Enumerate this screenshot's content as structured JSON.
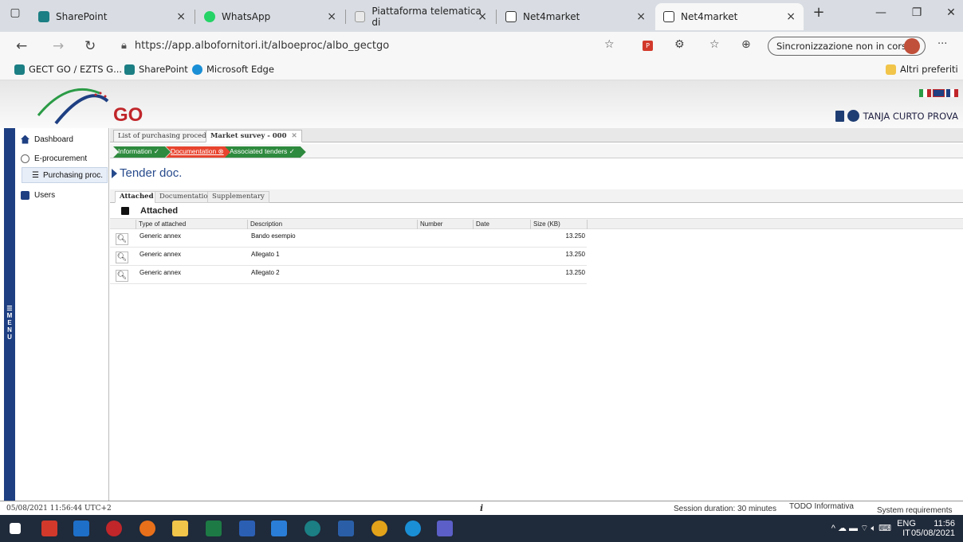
{
  "browser": {
    "tabs": [
      {
        "title": "SharePoint",
        "active": false
      },
      {
        "title": "WhatsApp",
        "active": false
      },
      {
        "title": "Piattaforma telematica di",
        "active": false
      },
      {
        "title": "Net4market",
        "active": false
      },
      {
        "title": "Net4market",
        "active": true
      }
    ],
    "new_tab": "+",
    "url": "https://app.albofornitori.it/alboeproc/albo_gectgo",
    "sync_label": "Sincronizzazione non in corso",
    "more": "···",
    "favorites": [
      "GECT GO / EZTS G...",
      "SharePoint",
      "Microsoft Edge"
    ],
    "other_favorites": "Altri preferiti"
  },
  "app": {
    "logo_text": "GO",
    "user_name": "TANJA CURTO PROVA",
    "menu_label": "MENU",
    "sidebar": [
      {
        "label": "Dashboard"
      },
      {
        "label": "E-procurement"
      },
      {
        "label": "Purchasing proc."
      },
      {
        "label": "Users"
      }
    ],
    "page_tabs": [
      {
        "label": "List of purchasing procedures"
      },
      {
        "label": "Market survey - 000"
      }
    ],
    "steps": [
      {
        "label": "Information",
        "status": "ok"
      },
      {
        "label": "Documentation",
        "status": "error"
      },
      {
        "label": "Associated tenders",
        "status": "ok"
      }
    ],
    "section_title": "Tender doc.",
    "doc_tabs": [
      "Attached",
      "Documentation",
      "Supplementary"
    ],
    "attached_header": "Attached",
    "columns": [
      "Type of attached",
      "Description",
      "Number",
      "Date",
      "Size (KB)"
    ],
    "rows": [
      {
        "type": "Generic annex",
        "description": "Bando esempio",
        "number": "",
        "date": "",
        "size": "13.250"
      },
      {
        "type": "Generic annex",
        "description": "Allegato 1",
        "number": "",
        "date": "",
        "size": "13.250"
      },
      {
        "type": "Generic annex",
        "description": "Allegato 2",
        "number": "",
        "date": "",
        "size": "13.250"
      }
    ]
  },
  "status_bar": {
    "timestamp": "05/08/2021 11:56:44 UTC+2",
    "info": "i",
    "session": "Session duration: 30 minutes",
    "todo": "TODO Informativa",
    "requirements": "System requirements"
  },
  "taskbar": {
    "lang": "ENG",
    "region": "IT",
    "time": "11:56",
    "date": "05/08/2021"
  },
  "colors": {
    "menu_blue": "#1e3f82",
    "title_blue": "#274a8c",
    "step_green": "#2e8a3e",
    "step_red": "#e8442e",
    "logo_red": "#c0262a"
  }
}
